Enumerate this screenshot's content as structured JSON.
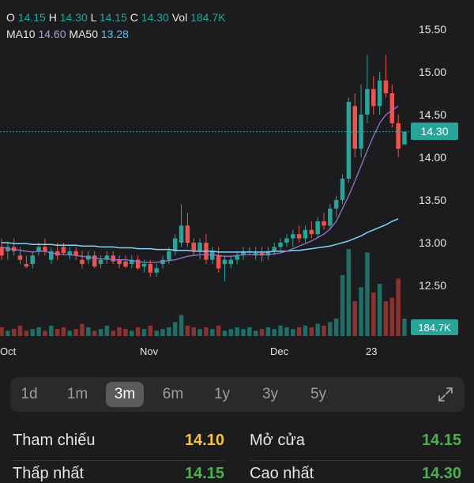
{
  "legend": {
    "o_label": "O",
    "o_value": "14.15",
    "h_label": "H",
    "h_value": "14.30",
    "l_label": "L",
    "l_value": "14.15",
    "c_label": "C",
    "c_value": "14.30",
    "vol_label": "Vol",
    "vol_value": "184.7K",
    "ma10_label": "MA10",
    "ma10_value": "14.60",
    "ma50_label": "MA50",
    "ma50_value": "13.28"
  },
  "y_axis": [
    "15.50",
    "15.00",
    "14.50",
    "14.00",
    "13.50",
    "13.00",
    "12.50"
  ],
  "x_axis": [
    "Oct",
    "Nov",
    "Dec",
    "23"
  ],
  "current_price": "14.30",
  "current_volume": "184.7K",
  "colors": {
    "up": "#26a69a",
    "down": "#ef5350",
    "ma10": "#9575cd",
    "ma50": "#81d4fa",
    "background": "#1c1c1e"
  },
  "ranges": [
    {
      "label": "1d",
      "active": false
    },
    {
      "label": "1m",
      "active": false
    },
    {
      "label": "3m",
      "active": true
    },
    {
      "label": "6m",
      "active": false
    },
    {
      "label": "1y",
      "active": false
    },
    {
      "label": "3y",
      "active": false
    },
    {
      "label": "5y",
      "active": false
    }
  ],
  "expand_icon": "expand-icon",
  "stats": {
    "reference_label": "Tham chiếu",
    "reference_value": "14.10",
    "open_label": "Mở cửa",
    "open_value": "14.15",
    "row2_left_label": "Thấp nhất",
    "row2_left_value": "14.15",
    "row2_right_label": "Cao nhất",
    "row2_right_value": "14.30"
  },
  "chart_data": {
    "type": "candlestick",
    "ylim": [
      12.2,
      15.6
    ],
    "candles": [
      {
        "o": 12.95,
        "h": 13.05,
        "l": 12.8,
        "c": 12.85
      },
      {
        "o": 12.9,
        "h": 13.0,
        "l": 12.8,
        "c": 12.95
      },
      {
        "o": 12.95,
        "h": 13.05,
        "l": 12.85,
        "c": 12.9
      },
      {
        "o": 12.85,
        "h": 12.95,
        "l": 12.75,
        "c": 12.8
      },
      {
        "o": 12.75,
        "h": 12.85,
        "l": 12.7,
        "c": 12.72
      },
      {
        "o": 12.75,
        "h": 12.9,
        "l": 12.7,
        "c": 12.85
      },
      {
        "o": 12.9,
        "h": 13.0,
        "l": 12.85,
        "c": 12.95
      },
      {
        "o": 12.95,
        "h": 13.05,
        "l": 12.85,
        "c": 12.9
      },
      {
        "o": 12.8,
        "h": 12.95,
        "l": 12.75,
        "c": 12.9
      },
      {
        "o": 12.9,
        "h": 13.0,
        "l": 12.8,
        "c": 12.85
      },
      {
        "o": 12.95,
        "h": 13.0,
        "l": 12.85,
        "c": 12.88
      },
      {
        "o": 12.85,
        "h": 12.95,
        "l": 12.8,
        "c": 12.9
      },
      {
        "o": 12.9,
        "h": 12.95,
        "l": 12.8,
        "c": 12.85
      },
      {
        "o": 12.8,
        "h": 12.9,
        "l": 12.7,
        "c": 12.75
      },
      {
        "o": 12.8,
        "h": 12.9,
        "l": 12.75,
        "c": 12.85
      },
      {
        "o": 12.85,
        "h": 12.9,
        "l": 12.7,
        "c": 12.72
      },
      {
        "o": 12.75,
        "h": 12.85,
        "l": 12.7,
        "c": 12.8
      },
      {
        "o": 12.8,
        "h": 12.9,
        "l": 12.75,
        "c": 12.85
      },
      {
        "o": 12.85,
        "h": 12.9,
        "l": 12.75,
        "c": 12.78
      },
      {
        "o": 12.8,
        "h": 12.85,
        "l": 12.7,
        "c": 12.75
      },
      {
        "o": 12.78,
        "h": 12.85,
        "l": 12.7,
        "c": 12.72
      },
      {
        "o": 12.75,
        "h": 12.85,
        "l": 12.7,
        "c": 12.8
      },
      {
        "o": 12.8,
        "h": 12.85,
        "l": 12.68,
        "c": 12.7
      },
      {
        "o": 12.72,
        "h": 12.8,
        "l": 12.65,
        "c": 12.75
      },
      {
        "o": 12.75,
        "h": 12.8,
        "l": 12.6,
        "c": 12.65
      },
      {
        "o": 12.65,
        "h": 12.75,
        "l": 12.6,
        "c": 12.7
      },
      {
        "o": 12.75,
        "h": 12.85,
        "l": 12.7,
        "c": 12.8
      },
      {
        "o": 12.8,
        "h": 12.95,
        "l": 12.75,
        "c": 12.9
      },
      {
        "o": 12.9,
        "h": 13.1,
        "l": 12.85,
        "c": 13.05
      },
      {
        "o": 13.0,
        "h": 13.45,
        "l": 12.95,
        "c": 13.2
      },
      {
        "o": 13.2,
        "h": 13.35,
        "l": 12.95,
        "c": 13.0
      },
      {
        "o": 13.0,
        "h": 13.05,
        "l": 12.85,
        "c": 12.9
      },
      {
        "o": 12.9,
        "h": 13.05,
        "l": 12.8,
        "c": 13.0
      },
      {
        "o": 13.0,
        "h": 13.1,
        "l": 12.75,
        "c": 12.8
      },
      {
        "o": 12.8,
        "h": 12.95,
        "l": 12.75,
        "c": 12.9
      },
      {
        "o": 12.85,
        "h": 12.95,
        "l": 12.65,
        "c": 12.7
      },
      {
        "o": 12.75,
        "h": 12.85,
        "l": 12.55,
        "c": 12.8
      },
      {
        "o": 12.75,
        "h": 12.85,
        "l": 12.7,
        "c": 12.8
      },
      {
        "o": 12.8,
        "h": 12.9,
        "l": 12.75,
        "c": 12.85
      },
      {
        "o": 12.85,
        "h": 12.95,
        "l": 12.8,
        "c": 12.9
      },
      {
        "o": 12.9,
        "h": 12.95,
        "l": 12.85,
        "c": 12.9
      },
      {
        "o": 12.85,
        "h": 12.95,
        "l": 12.8,
        "c": 12.88
      },
      {
        "o": 12.88,
        "h": 12.95,
        "l": 12.78,
        "c": 12.85
      },
      {
        "o": 12.85,
        "h": 12.95,
        "l": 12.8,
        "c": 12.9
      },
      {
        "o": 12.9,
        "h": 13.0,
        "l": 12.85,
        "c": 12.95
      },
      {
        "o": 12.95,
        "h": 13.05,
        "l": 12.9,
        "c": 13.0
      },
      {
        "o": 13.0,
        "h": 13.1,
        "l": 12.95,
        "c": 13.05
      },
      {
        "o": 13.05,
        "h": 13.15,
        "l": 12.95,
        "c": 13.1
      },
      {
        "o": 13.1,
        "h": 13.2,
        "l": 13.0,
        "c": 13.05
      },
      {
        "o": 13.05,
        "h": 13.2,
        "l": 13.0,
        "c": 13.15
      },
      {
        "o": 13.15,
        "h": 13.25,
        "l": 13.05,
        "c": 13.1
      },
      {
        "o": 13.1,
        "h": 13.3,
        "l": 13.05,
        "c": 13.25
      },
      {
        "o": 13.25,
        "h": 13.35,
        "l": 13.15,
        "c": 13.2
      },
      {
        "o": 13.2,
        "h": 13.45,
        "l": 13.15,
        "c": 13.4
      },
      {
        "o": 13.4,
        "h": 13.55,
        "l": 13.3,
        "c": 13.5
      },
      {
        "o": 13.5,
        "h": 13.8,
        "l": 13.45,
        "c": 13.75
      },
      {
        "o": 13.75,
        "h": 14.7,
        "l": 13.7,
        "c": 14.65
      },
      {
        "o": 14.6,
        "h": 14.75,
        "l": 14.0,
        "c": 14.1
      },
      {
        "o": 14.1,
        "h": 14.85,
        "l": 14.0,
        "c": 14.5
      },
      {
        "o": 14.5,
        "h": 15.2,
        "l": 14.4,
        "c": 14.8
      },
      {
        "o": 14.8,
        "h": 14.95,
        "l": 14.5,
        "c": 14.6
      },
      {
        "o": 14.6,
        "h": 15.0,
        "l": 14.5,
        "c": 14.9
      },
      {
        "o": 14.9,
        "h": 15.2,
        "l": 14.7,
        "c": 14.75
      },
      {
        "o": 14.75,
        "h": 14.85,
        "l": 14.35,
        "c": 14.4
      },
      {
        "o": 14.4,
        "h": 14.5,
        "l": 14.0,
        "c": 14.1
      },
      {
        "o": 14.15,
        "h": 14.3,
        "l": 14.15,
        "c": 14.3
      }
    ],
    "ma10": [
      12.95,
      12.93,
      12.92,
      12.91,
      12.9,
      12.89,
      12.9,
      12.9,
      12.88,
      12.87,
      12.86,
      12.86,
      12.85,
      12.84,
      12.83,
      12.82,
      12.81,
      12.81,
      12.8,
      12.8,
      12.8,
      12.79,
      12.78,
      12.77,
      12.77,
      12.77,
      12.78,
      12.79,
      12.8,
      12.82,
      12.84,
      12.85,
      12.86,
      12.86,
      12.86,
      12.85,
      12.84,
      12.84,
      12.85,
      12.86,
      12.86,
      12.86,
      12.86,
      12.86,
      12.87,
      12.88,
      12.9,
      12.93,
      12.96,
      12.99,
      13.02,
      13.06,
      13.1,
      13.16,
      13.25,
      13.4,
      13.55,
      13.72,
      13.9,
      14.08,
      14.25,
      14.4,
      14.5,
      14.55,
      14.6
    ],
    "ma50": [
      13.0,
      13.0,
      12.99,
      12.99,
      12.99,
      12.98,
      12.98,
      12.98,
      12.98,
      12.97,
      12.97,
      12.97,
      12.97,
      12.96,
      12.96,
      12.96,
      12.95,
      12.95,
      12.95,
      12.94,
      12.94,
      12.94,
      12.93,
      12.93,
      12.93,
      12.92,
      12.92,
      12.92,
      12.91,
      12.91,
      12.91,
      12.9,
      12.9,
      12.9,
      12.9,
      12.89,
      12.89,
      12.89,
      12.89,
      12.89,
      12.89,
      12.89,
      12.89,
      12.89,
      12.9,
      12.9,
      12.9,
      12.91,
      12.91,
      12.92,
      12.93,
      12.94,
      12.95,
      12.96,
      12.98,
      13.0,
      13.02,
      13.05,
      13.08,
      13.12,
      13.15,
      13.18,
      13.21,
      13.25,
      13.28
    ],
    "volume": [
      5,
      3,
      4,
      6,
      3,
      4,
      5,
      3,
      6,
      4,
      5,
      3,
      4,
      7,
      5,
      3,
      4,
      6,
      3,
      5,
      4,
      3,
      5,
      4,
      6,
      3,
      4,
      5,
      8,
      12,
      6,
      5,
      4,
      5,
      4,
      6,
      3,
      4,
      5,
      4,
      5,
      3,
      4,
      5,
      4,
      6,
      5,
      4,
      5,
      6,
      5,
      7,
      6,
      8,
      10,
      35,
      50,
      20,
      28,
      48,
      25,
      30,
      20,
      22,
      33,
      10
    ]
  }
}
